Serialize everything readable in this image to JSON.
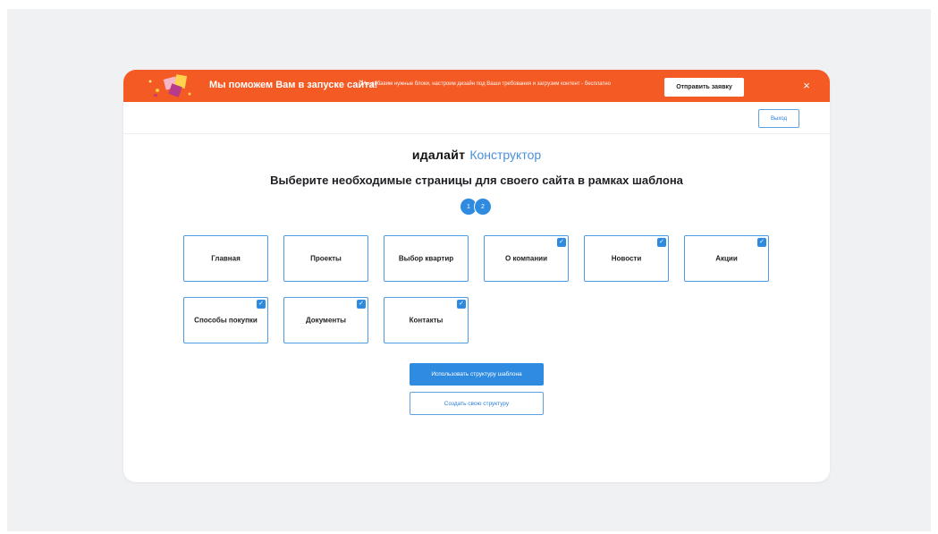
{
  "promo": {
    "title": "Мы поможем Вам в запуске сайта!",
    "subtitle": "Мы добавим нужные блоки, настроим дизайн под Ваши требования и загрузим контент - бесплатно",
    "button_label": "Отправить заявку",
    "close_label": "×",
    "background_color": "#f45a23"
  },
  "topbar": {
    "exit_label": "Выход"
  },
  "brand": {
    "logo": "идалайт",
    "product": "Конструктор"
  },
  "heading": "Выберите необходимые страницы для своего сайта в рамках шаблона",
  "steps": [
    "1",
    "2"
  ],
  "pages": [
    {
      "label": "Главная",
      "checked": false
    },
    {
      "label": "Проекты",
      "checked": false
    },
    {
      "label": "Выбор квартир",
      "checked": false
    },
    {
      "label": "О компании",
      "checked": true
    },
    {
      "label": "Новости",
      "checked": true
    },
    {
      "label": "Акции",
      "checked": true
    },
    {
      "label": "Способы покупки",
      "checked": true
    },
    {
      "label": "Документы",
      "checked": true
    },
    {
      "label": "Контакты",
      "checked": true
    }
  ],
  "actions": {
    "primary_label": "Использовать структуру шаблона",
    "secondary_label": "Создать свою структуру"
  },
  "colors": {
    "accent": "#2f8be0",
    "card_border": "#4d9be3"
  },
  "icons": {
    "check": "checkmark-icon",
    "close": "close-icon"
  }
}
